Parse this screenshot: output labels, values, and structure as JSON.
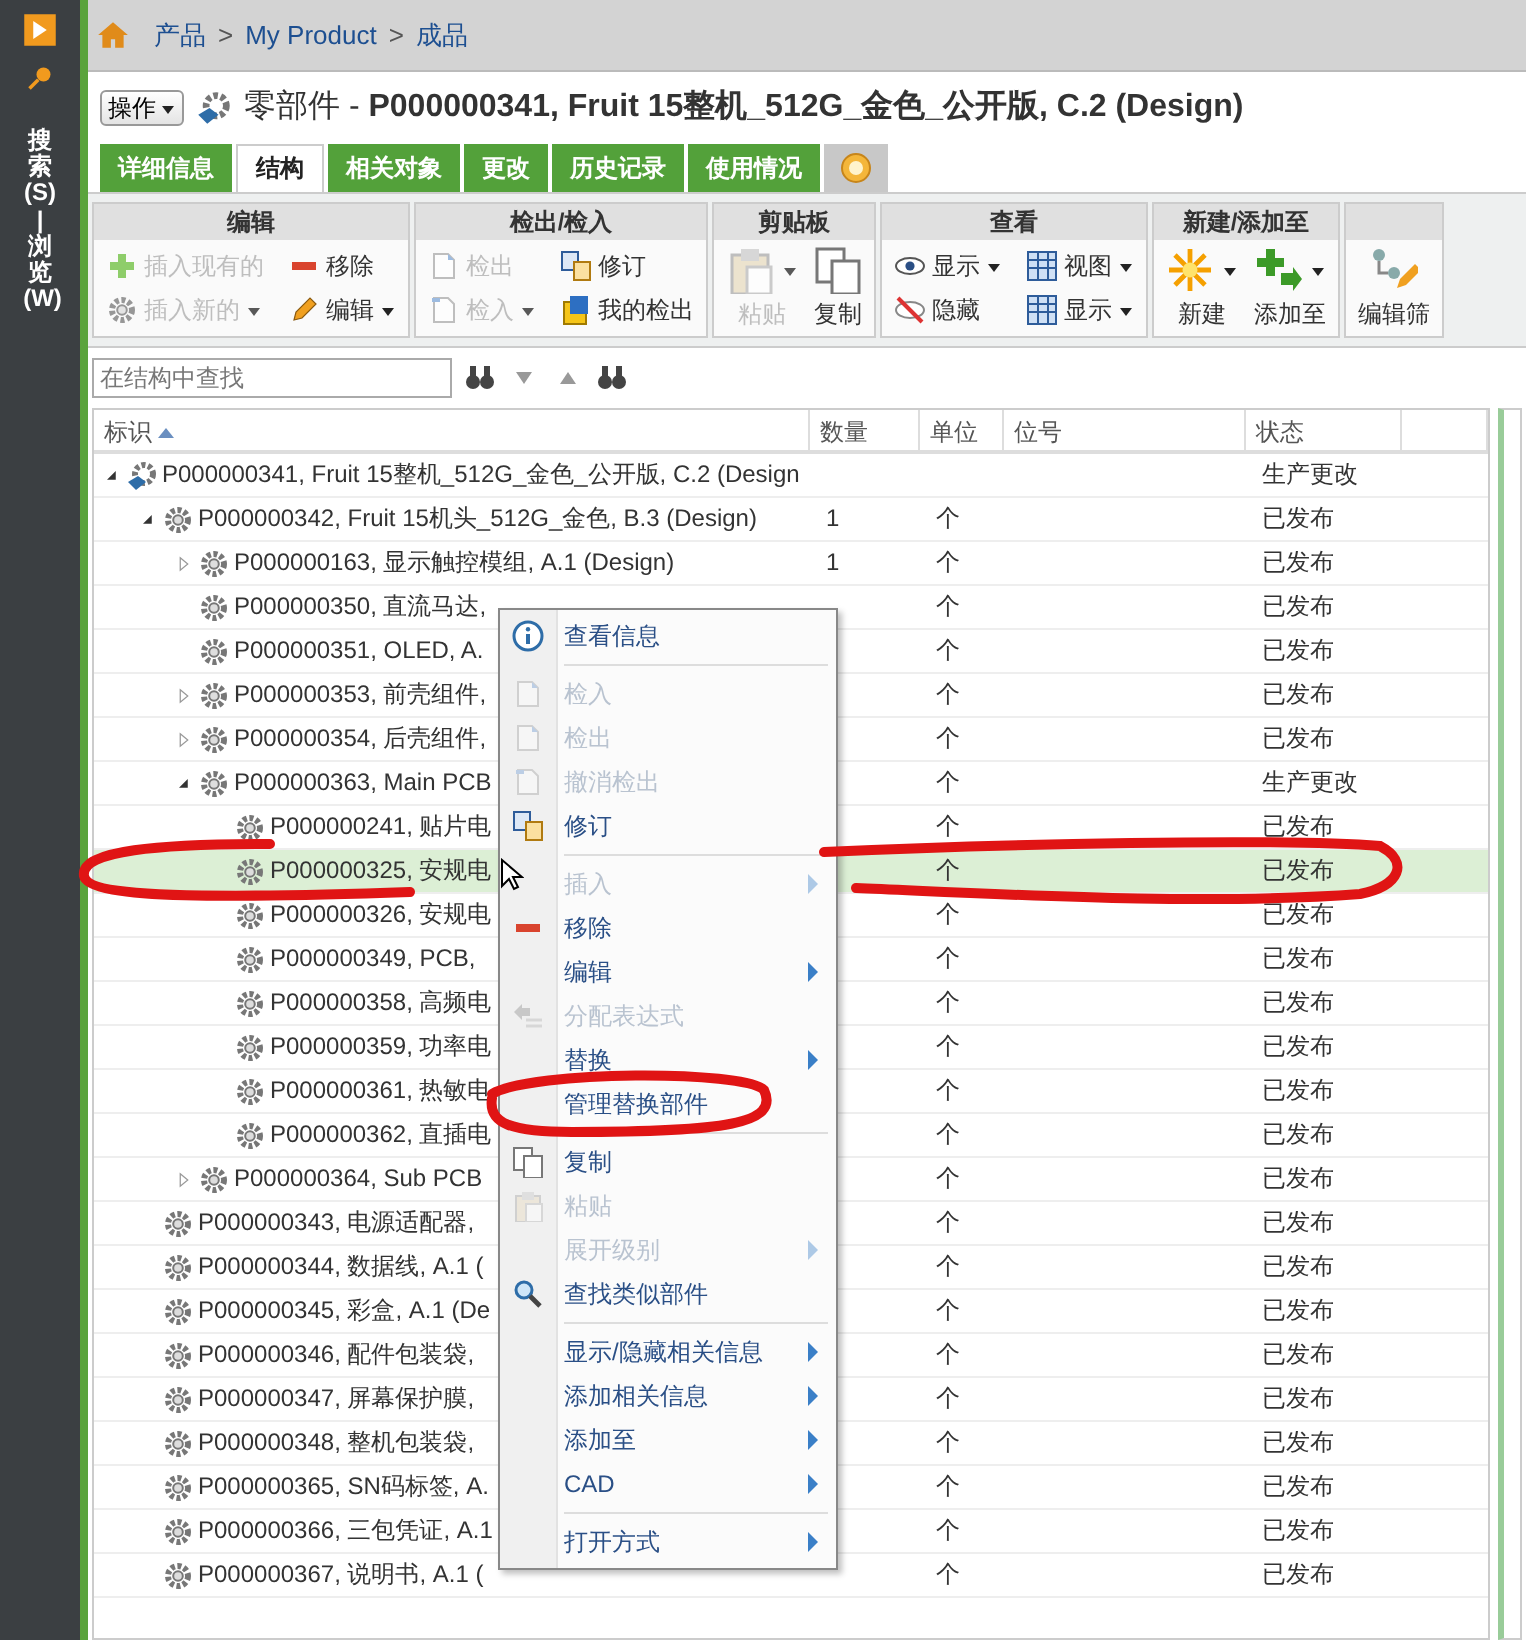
{
  "sidebar": {
    "label": "搜索(S) | 浏览(W)"
  },
  "breadcrumb": {
    "items": [
      "产品",
      "My Product",
      "成品"
    ],
    "separator": ">"
  },
  "header": {
    "actions_button": "操作",
    "title": "零部件 - **P000000341, Fruit 15整机_512G_金色_公开版, C.2 (Design)**"
  },
  "tabs": [
    {
      "kind": "text",
      "label": "详细信息",
      "selected": false
    },
    {
      "kind": "text",
      "label": "结构",
      "selected": true
    },
    {
      "kind": "text",
      "label": "相关对象",
      "selected": false
    },
    {
      "kind": "text",
      "label": "更改",
      "selected": false
    },
    {
      "kind": "text",
      "label": "历史记录",
      "selected": false
    },
    {
      "kind": "text",
      "label": "使用情况",
      "selected": false
    },
    {
      "kind": "icon",
      "selected": false
    }
  ],
  "toolbar": [
    {
      "title": "编辑",
      "buttons": [
        {
          "kind": "small",
          "label": "插入现有的",
          "disabled": true,
          "dropdown": false
        },
        {
          "kind": "small",
          "label": "移除",
          "disabled": false,
          "dropdown": false
        },
        {
          "kind": "small",
          "label": "插入新的",
          "disabled": true,
          "dropdown": true
        },
        {
          "kind": "small",
          "label": "编辑",
          "disabled": false,
          "dropdown": true
        }
      ]
    },
    {
      "title": "检出/检入",
      "buttons": [
        {
          "kind": "small",
          "label": "检出",
          "disabled": true,
          "dropdown": false
        },
        {
          "kind": "small",
          "label": "修订",
          "disabled": false,
          "dropdown": false
        },
        {
          "kind": "small",
          "label": "检入",
          "disabled": true,
          "dropdown": true
        },
        {
          "kind": "small",
          "label": "我的检出",
          "disabled": false,
          "dropdown": false
        }
      ]
    },
    {
      "title": "剪贴板",
      "buttons": [
        {
          "kind": "large",
          "label": "粘贴",
          "disabled": true,
          "dropdown": true
        },
        {
          "kind": "large",
          "label": "复制",
          "disabled": false,
          "dropdown": false
        }
      ]
    },
    {
      "title": "查看",
      "buttons": [
        {
          "kind": "small",
          "label": "显示",
          "disabled": false,
          "dropdown": true
        },
        {
          "kind": "small",
          "label": "视图",
          "disabled": false,
          "dropdown": true
        },
        {
          "kind": "small",
          "label": "隐藏",
          "disabled": false,
          "dropdown": false
        },
        {
          "kind": "small",
          "label": "显示",
          "disabled": false,
          "dropdown": true
        }
      ]
    },
    {
      "title": "新建/添加至",
      "buttons": [
        {
          "kind": "large",
          "label": "新建",
          "disabled": false,
          "dropdown": true
        },
        {
          "kind": "large",
          "label": "添加至",
          "disabled": false,
          "dropdown": true
        }
      ]
    },
    {
      "buttons": [
        {
          "kind": "large",
          "label": "编辑筛",
          "disabled": false,
          "dropdown": false
        }
      ]
    }
  ],
  "search": {
    "placeholder": "在结构中查找"
  },
  "table": {
    "columns": [
      {
        "label": "标识",
        "sorted": true
      },
      {
        "label": "数量",
        "sorted": false
      },
      {
        "label": "单位",
        "sorted": false
      },
      {
        "label": "位号",
        "sorted": false
      },
      {
        "label": "状态",
        "sorted": false
      }
    ],
    "rows": [
      {
        "name": "P000000341, Fruit 15整机_512G_金色_公开版, C.2 (Design",
        "status": "生产更改",
        "expanded": true,
        "selected": false,
        "children": [
          {
            "name": "P000000342, Fruit 15机头_512G_金色, B.3 (Design)",
            "qty": "1",
            "unit": "个",
            "status": "已发布",
            "expanded": true,
            "selected": false,
            "children": [
              {
                "name": "P000000163, 显示触控模组, A.1 (Design)",
                "qty": "1",
                "unit": "个",
                "status": "已发布",
                "expanded": false,
                "selected": false
              },
              {
                "name": "P000000350, 直流马达,",
                "unit": "个",
                "status": "已发布",
                "selected": false
              },
              {
                "name": "P000000351, OLED, A.",
                "unit": "个",
                "status": "已发布",
                "selected": false
              },
              {
                "name": "P000000353, 前壳组件,",
                "unit": "个",
                "status": "已发布",
                "expanded": false,
                "selected": false
              },
              {
                "name": "P000000354, 后壳组件,",
                "unit": "个",
                "status": "已发布",
                "expanded": false,
                "selected": false
              },
              {
                "name": "P000000363, Main PCB",
                "unit": "个",
                "status": "生产更改",
                "expanded": true,
                "selected": false,
                "children": [
                  {
                    "name": "P000000241, 贴片电",
                    "unit": "个",
                    "status": "已发布",
                    "selected": false
                  },
                  {
                    "name": "P000000325, 安规电",
                    "unit": "个",
                    "status": "已发布",
                    "selected": true
                  },
                  {
                    "name": "P000000326, 安规电",
                    "unit": "个",
                    "status": "已发布",
                    "selected": false
                  },
                  {
                    "name": "P000000349, PCB,",
                    "unit": "个",
                    "status": "已发布",
                    "selected": false
                  },
                  {
                    "name": "P000000358, 高频电",
                    "unit": "个",
                    "status": "已发布",
                    "selected": false
                  },
                  {
                    "name": "P000000359, 功率电",
                    "unit": "个",
                    "status": "已发布",
                    "selected": false
                  },
                  {
                    "name": "P000000361, 热敏电",
                    "unit": "个",
                    "status": "已发布",
                    "selected": false
                  },
                  {
                    "name": "P000000362, 直插电",
                    "unit": "个",
                    "status": "已发布",
                    "selected": false
                  }
                ]
              },
              {
                "name": "P000000364, Sub PCB",
                "unit": "个",
                "status": "已发布",
                "expanded": false,
                "selected": false
              }
            ]
          },
          {
            "name": "P000000343, 电源适配器,",
            "unit": "个",
            "status": "已发布",
            "selected": false
          },
          {
            "name": "P000000344, 数据线, A.1 (",
            "unit": "个",
            "status": "已发布",
            "selected": false
          },
          {
            "name": "P000000345, 彩盒, A.1 (De",
            "unit": "个",
            "status": "已发布",
            "selected": false
          },
          {
            "name": "P000000346, 配件包装袋,",
            "unit": "个",
            "status": "已发布",
            "selected": false
          },
          {
            "name": "P000000347, 屏幕保护膜,",
            "unit": "个",
            "status": "已发布",
            "selected": false
          },
          {
            "name": "P000000348, 整机包装袋,",
            "unit": "个",
            "status": "已发布",
            "selected": false
          },
          {
            "name": "P000000365, SN码标签, A.",
            "unit": "个",
            "status": "已发布",
            "selected": false
          },
          {
            "name": "P000000366, 三包凭证, A.1",
            "unit": "个",
            "status": "已发布",
            "selected": false
          },
          {
            "name": "P000000367, 说明书, A.1 (",
            "unit": "个",
            "status": "已发布",
            "selected": false
          }
        ]
      }
    ]
  },
  "context_menu": [
    {
      "kind": "item",
      "label": "查看信息",
      "disabled": false,
      "submenu": false
    },
    {
      "kind": "separator"
    },
    {
      "kind": "item",
      "label": "检入",
      "disabled": true,
      "submenu": false
    },
    {
      "kind": "item",
      "label": "检出",
      "disabled": true,
      "submenu": false
    },
    {
      "kind": "item",
      "label": "撤消检出",
      "disabled": true,
      "submenu": false
    },
    {
      "kind": "item",
      "label": "修订",
      "disabled": false,
      "submenu": false
    },
    {
      "kind": "separator"
    },
    {
      "kind": "item",
      "label": "插入",
      "disabled": true,
      "submenu": true
    },
    {
      "kind": "item",
      "label": "移除",
      "disabled": false,
      "submenu": false
    },
    {
      "kind": "item",
      "label": "编辑",
      "disabled": false,
      "submenu": true
    },
    {
      "kind": "item",
      "label": "分配表达式",
      "disabled": true,
      "submenu": false
    },
    {
      "kind": "item",
      "label": "替换",
      "disabled": false,
      "submenu": true
    },
    {
      "kind": "item",
      "label": "管理替换部件",
      "disabled": false,
      "submenu": false
    },
    {
      "kind": "separator"
    },
    {
      "kind": "item",
      "label": "复制",
      "disabled": false,
      "submenu": false
    },
    {
      "kind": "item",
      "label": "粘贴",
      "disabled": true,
      "submenu": false
    },
    {
      "kind": "item",
      "label": "展开级别",
      "disabled": true,
      "submenu": true
    },
    {
      "kind": "item",
      "label": "查找类似部件",
      "disabled": false,
      "submenu": false
    },
    {
      "kind": "separator"
    },
    {
      "kind": "item",
      "label": "显示/隐藏相关信息",
      "disabled": false,
      "submenu": true
    },
    {
      "kind": "item",
      "label": "添加相关信息",
      "disabled": false,
      "submenu": true
    },
    {
      "kind": "item",
      "label": "添加至",
      "disabled": false,
      "submenu": true
    },
    {
      "kind": "item",
      "label": "CAD",
      "disabled": false,
      "submenu": true
    },
    {
      "kind": "separator"
    },
    {
      "kind": "item",
      "label": "打开方式",
      "disabled": false,
      "submenu": true
    }
  ]
}
